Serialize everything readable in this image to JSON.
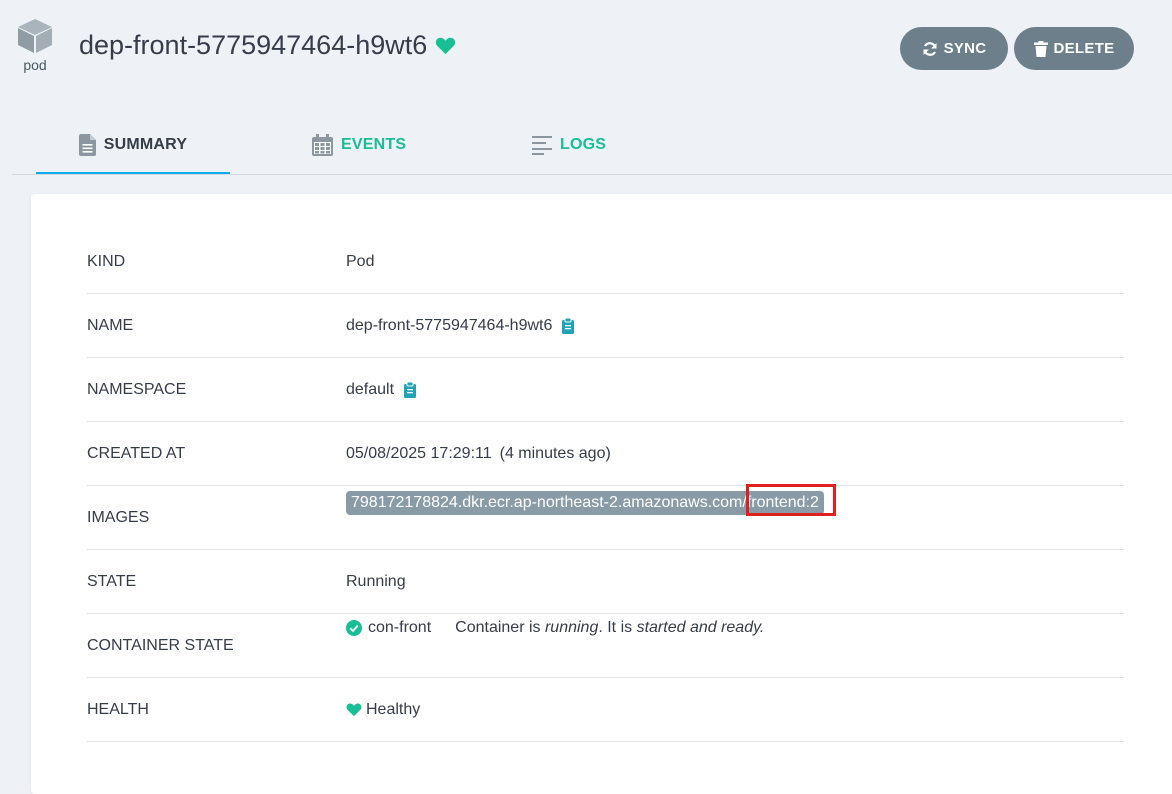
{
  "header": {
    "kind_label": "pod",
    "title": "dep-front-5775947464-h9wt6",
    "health_icon": "heart-icon",
    "sync_label": "SYNC",
    "delete_label": "DELETE"
  },
  "tabs": [
    {
      "label": "SUMMARY",
      "icon": "document-icon",
      "active": true
    },
    {
      "label": "EVENTS",
      "icon": "calendar-icon",
      "active": false
    },
    {
      "label": "LOGS",
      "icon": "lines-icon",
      "active": false
    }
  ],
  "summary": {
    "kind": {
      "key": "KIND",
      "value": "Pod"
    },
    "name": {
      "key": "NAME",
      "value": "dep-front-5775947464-h9wt6"
    },
    "namespace": {
      "key": "NAMESPACE",
      "value": "default"
    },
    "created_at": {
      "key": "CREATED AT",
      "value": "05/08/2025 17:29:11",
      "relative": "(4 minutes ago)"
    },
    "images": {
      "key": "IMAGES",
      "value": "798172178824.dkr.ecr.ap-northeast-2.amazonaws.com/frontend:2"
    },
    "state": {
      "key": "STATE",
      "value": "Running"
    },
    "container_state": {
      "key": "CONTAINER STATE",
      "container": "con-front",
      "msg_prefix": "Container is",
      "msg_running": "running",
      "msg_middle": ". It is",
      "msg_ready": "started and ready."
    },
    "health": {
      "key": "HEALTH",
      "value": "Healthy"
    }
  },
  "colors": {
    "accent_teal": "#18be94",
    "tab_underline": "#0dadea",
    "button_gray": "#6d7f8b",
    "chip_gray": "#8a9ba8",
    "highlight_red": "#e02020",
    "clipboard_teal": "#1fa3b7"
  }
}
